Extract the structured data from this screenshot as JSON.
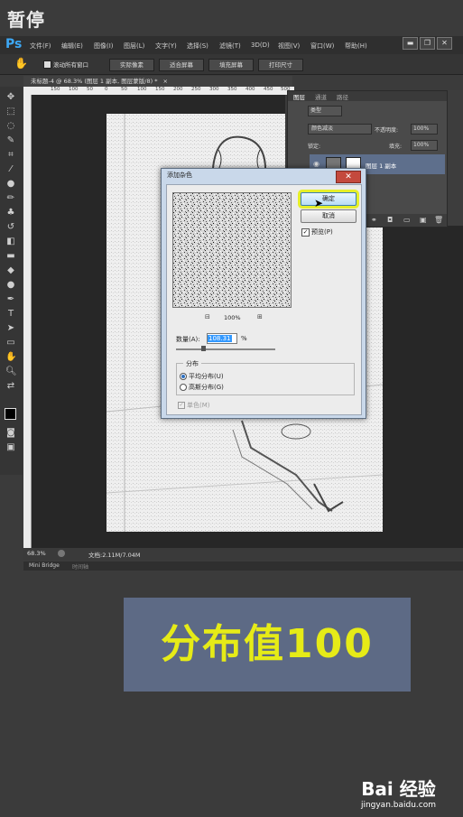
{
  "overlay": {
    "pause_label": "暂停"
  },
  "menubar": {
    "logo": "Ps",
    "items": [
      "文件(F)",
      "编辑(E)",
      "图像(I)",
      "图层(L)",
      "文字(Y)",
      "选择(S)",
      "滤镜(T)",
      "3D(D)",
      "视图(V)",
      "窗口(W)",
      "帮助(H)"
    ],
    "window_buttons": [
      "▬",
      "❐",
      "✕"
    ]
  },
  "options": {
    "scroll_all_label": "滚动所有窗口",
    "buttons": [
      "实际像素",
      "适合屏幕",
      "填充屏幕",
      "打印尺寸"
    ]
  },
  "document": {
    "tab_title": "未标题-4 @ 68.3% (图层 1 副本, 图层蒙版/8) *",
    "tab_close": "×",
    "ruler_ticks": [
      "150",
      "100",
      "50",
      "0",
      "50",
      "100",
      "150",
      "200",
      "250",
      "300",
      "350",
      "400",
      "450",
      "500"
    ]
  },
  "layers_panel": {
    "tabs": [
      "图层",
      "通道",
      "路径"
    ],
    "filter_label": "类型",
    "blend_mode": "颜色减淡",
    "opacity_label": "不透明度:",
    "opacity_value": "100%",
    "lock_label": "锁定:",
    "fill_label": "填充:",
    "fill_value": "100%",
    "layer_name": "图层 1 副本"
  },
  "status": {
    "zoom": "68.3%",
    "doc_info": "文档:2.11M/7.04M",
    "bridge_tabs": [
      "Mini Bridge",
      "时间轴"
    ]
  },
  "dialog": {
    "title": "添加杂色",
    "close": "✕",
    "ok_label": "确定",
    "cancel_label": "取消",
    "preview_label": "预览(P)",
    "zoom_value": "100%",
    "zoom_out": "⊟",
    "zoom_in": "⊞",
    "amount_label": "数量(A):",
    "amount_value": "108.31",
    "amount_unit": "%",
    "amount_fraction": 0.27,
    "group_label": "分布",
    "uniform_label": "平均分布(U)",
    "gaussian_label": "高斯分布(G)",
    "mono_label": "单色(M)",
    "colors": {
      "accent": "#3399ff",
      "title_bar": "#c9d8ea",
      "close": "#c4493d"
    }
  },
  "caption": {
    "text": "分布值100",
    "text_color": "#e6eb17",
    "bg_color": "#5d6a85"
  },
  "watermark": {
    "brand": "Bai 经验",
    "url": "jingyan.baidu.com"
  }
}
